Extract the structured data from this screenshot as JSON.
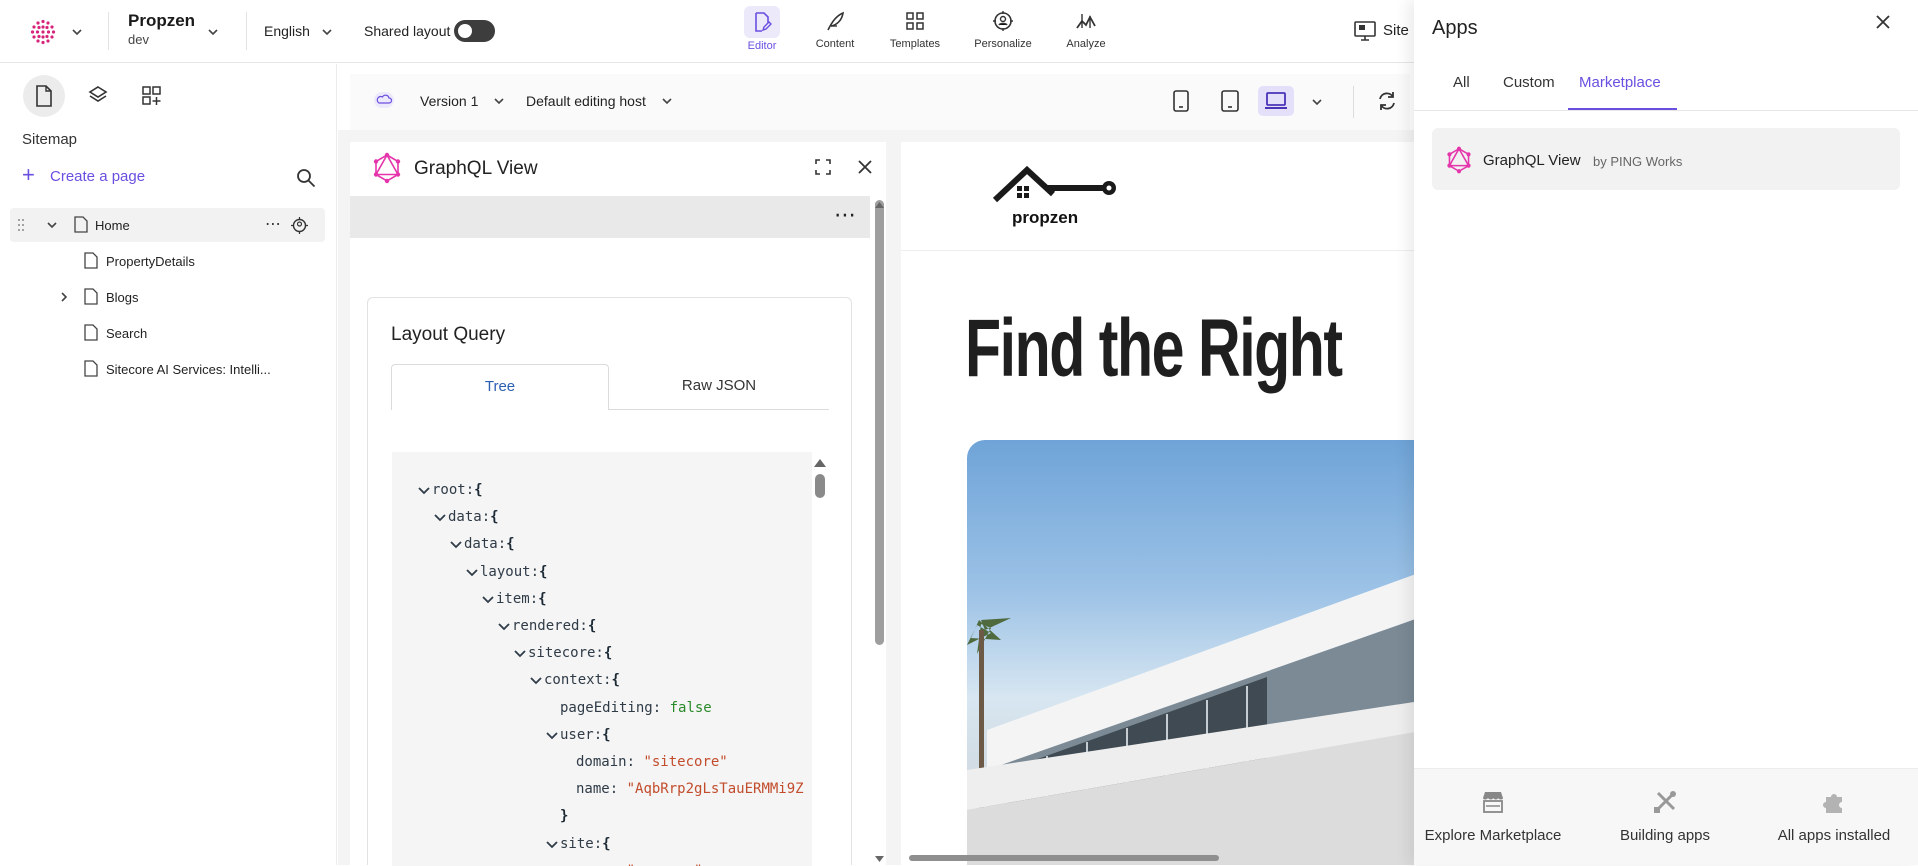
{
  "topbar": {
    "project_name": "Propzen",
    "environment": "dev",
    "language": "English",
    "shared_layout_label": "Shared layout",
    "nav_tabs": [
      {
        "label": "Editor",
        "active": true
      },
      {
        "label": "Content"
      },
      {
        "label": "Templates"
      },
      {
        "label": "Personalize"
      },
      {
        "label": "Analyze"
      }
    ],
    "site_label": "Site"
  },
  "sidebar": {
    "section_title": "Sitemap",
    "create_page_label": "Create a page",
    "tree": [
      {
        "label": "Home",
        "level": 0,
        "expanded": true,
        "selected": true
      },
      {
        "label": "PropertyDetails",
        "level": 1
      },
      {
        "label": "Blogs",
        "level": 1,
        "collapsed": true
      },
      {
        "label": "Search",
        "level": 1
      },
      {
        "label": "Sitecore AI Services: Intelli...",
        "level": 1
      }
    ]
  },
  "canvas_toolbar": {
    "version_label": "Version 1",
    "host_label": "Default editing host"
  },
  "graphql_panel": {
    "title": "GraphQL View",
    "card_title": "Layout Query",
    "tabs": [
      "Tree",
      "Raw JSON"
    ],
    "active_tab": "Tree",
    "tree_lines": [
      {
        "indent": 0,
        "chev": true,
        "key": "root",
        "open": "{"
      },
      {
        "indent": 1,
        "chev": true,
        "key": "data",
        "open": "{"
      },
      {
        "indent": 2,
        "chev": true,
        "key": "data",
        "open": "{"
      },
      {
        "indent": 3,
        "chev": true,
        "key": "layout",
        "open": "{"
      },
      {
        "indent": 4,
        "chev": true,
        "key": "item",
        "open": "{"
      },
      {
        "indent": 5,
        "chev": true,
        "key": "rendered",
        "open": "{"
      },
      {
        "indent": 6,
        "chev": true,
        "key": "sitecore",
        "open": "{"
      },
      {
        "indent": 7,
        "chev": true,
        "key": "context",
        "open": "{"
      },
      {
        "indent": 8,
        "chev": false,
        "key": "pageEditing",
        "value": "false",
        "type": "bool"
      },
      {
        "indent": 8,
        "chev": true,
        "key": "user",
        "open": "{"
      },
      {
        "indent": 9,
        "chev": false,
        "key": "domain",
        "value": "\"sitecore\"",
        "type": "str"
      },
      {
        "indent": 9,
        "chev": false,
        "key": "name",
        "value": "\"AqbRrp2gLsTauERMMi9Z",
        "type": "str"
      },
      {
        "indent": 8,
        "chev": false,
        "close": "}"
      },
      {
        "indent": 8,
        "chev": true,
        "key": "site",
        "open": "{"
      },
      {
        "indent": 9,
        "chev": false,
        "key": "name",
        "value": "\"propzen\"",
        "type": "str"
      }
    ]
  },
  "preview": {
    "logo_text": "propzen",
    "headline": "Find the Right"
  },
  "apps_panel": {
    "title": "Apps",
    "tabs": [
      "All",
      "Custom",
      "Marketplace"
    ],
    "active_tab": "Marketplace",
    "app_name": "GraphQL View",
    "app_vendor": "by PING Works",
    "footer": [
      "Explore Marketplace",
      "Building apps",
      "All apps installed"
    ]
  },
  "colors": {
    "accent": "#6b4fe0",
    "graphql_pink": "#e535ab",
    "toggle_off": "#3d3d3d"
  }
}
